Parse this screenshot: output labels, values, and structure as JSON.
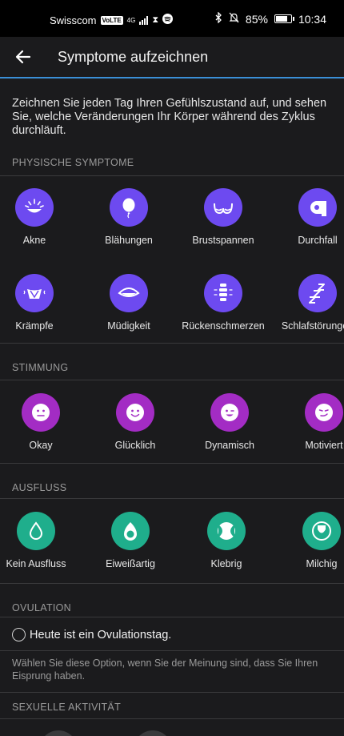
{
  "status": {
    "carrier": "Swisscom",
    "volte": "VoLTE",
    "net": "4G",
    "battery": "85%",
    "time": "10:34",
    "battery_level": 0.85
  },
  "header": {
    "title": "Symptome aufzeichnen"
  },
  "intro": "Zeichnen Sie jeden Tag Ihren Gefühlszustand auf, und sehen Sie, welche Veränderungen Ihr Körper während des Zyklus durchläuft.",
  "sections": {
    "physical": {
      "title": "PHYSISCHE SYMPTOME",
      "row1": [
        "Akne",
        "Blähungen",
        "Brustspannen",
        "Durchfall"
      ],
      "row2": [
        "Krämpfe",
        "Müdigkeit",
        "Rückenschmerzen",
        "Schlafstörungen"
      ]
    },
    "mood": {
      "title": "STIMMUNG",
      "items": [
        "Okay",
        "Glücklich",
        "Dynamisch",
        "Motiviert"
      ]
    },
    "discharge": {
      "title": "AUSFLUSS",
      "items": [
        "Kein Ausfluss",
        "Eiweißartig",
        "Klebrig",
        "Milchig"
      ]
    },
    "ovulation": {
      "title": "OVULATION",
      "checkbox_label": "Heute ist ein Ovulationstag.",
      "hint": "Wählen Sie diese Option, wenn Sie der Meinung sind, dass Sie Ihren Eisprung haben."
    },
    "sexual": {
      "title": "SEXUELLE AKTIVITÄT"
    }
  },
  "colors": {
    "purple": "#6d4af0",
    "magenta": "#a32cc4",
    "green": "#1fae8c",
    "accent": "#3a8fd6"
  }
}
